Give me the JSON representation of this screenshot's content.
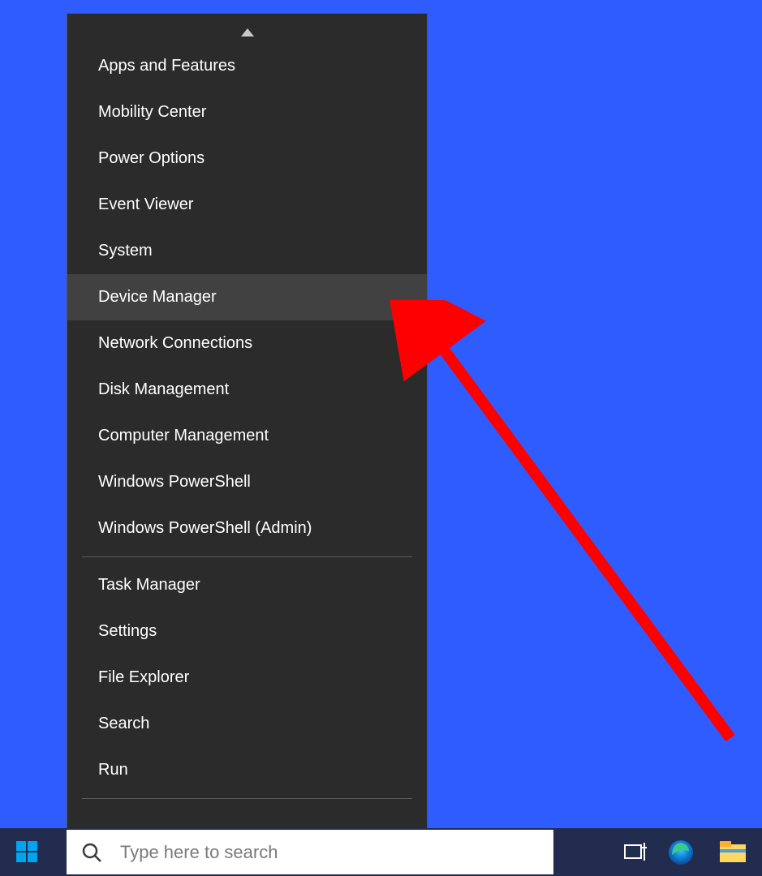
{
  "menu": {
    "highlighted_index": 5,
    "groups": [
      {
        "items": [
          {
            "label": "Apps and Features"
          },
          {
            "label": "Mobility Center"
          },
          {
            "label": "Power Options"
          },
          {
            "label": "Event Viewer"
          },
          {
            "label": "System"
          },
          {
            "label": "Device Manager"
          },
          {
            "label": "Network Connections"
          },
          {
            "label": "Disk Management"
          },
          {
            "label": "Computer Management"
          },
          {
            "label": "Windows PowerShell"
          },
          {
            "label": "Windows PowerShell (Admin)"
          }
        ]
      },
      {
        "items": [
          {
            "label": "Task Manager"
          },
          {
            "label": "Settings"
          },
          {
            "label": "File Explorer"
          },
          {
            "label": "Search"
          },
          {
            "label": "Run"
          }
        ]
      }
    ]
  },
  "taskbar": {
    "search_placeholder": "Type here to search"
  },
  "colors": {
    "desktop": "#2e5cff",
    "menu_bg": "#2b2b2b",
    "menu_hover": "#414141",
    "taskbar_bg": "#212c4e",
    "arrow": "#ff0000"
  }
}
